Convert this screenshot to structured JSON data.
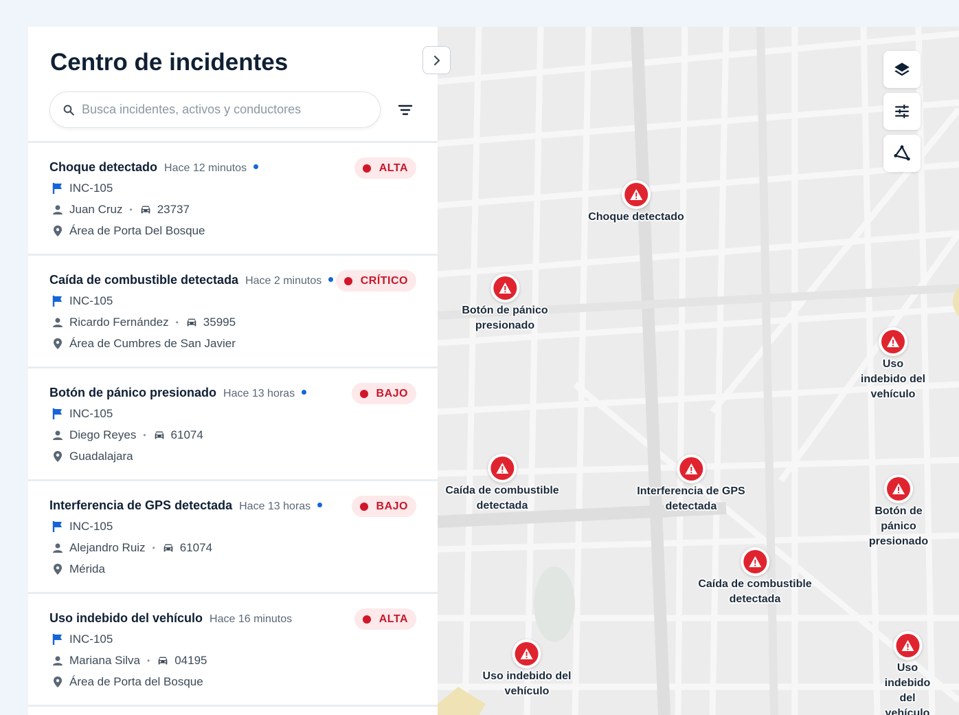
{
  "panel": {
    "title": "Centro de incidentes",
    "search_placeholder": "Busca incidentes, activos y conductores"
  },
  "colors": {
    "accent_red": "#e0242f",
    "flag_blue": "#1565d8",
    "badge_bg": "#fde8ea"
  },
  "icons": {
    "search": "search-icon",
    "filter": "filter-icon",
    "collapse": "chevron-right-icon",
    "flag": "flag-icon",
    "driver": "person-icon",
    "vehicle": "car-icon",
    "location": "location-pin-icon",
    "layers": "layers-icon",
    "settings": "sliders-icon",
    "draw": "polygon-icon",
    "alert": "warning-triangle-icon"
  },
  "incidents": [
    {
      "title": "Choque detectado",
      "time": "Hace 12 minutos",
      "unread": true,
      "severity": "ALTA",
      "id": "INC-105",
      "driver": "Juan Cruz",
      "vehicle": "23737",
      "location": "Área de Porta Del Bosque"
    },
    {
      "title": "Caída de combustible detectada",
      "time": "Hace 2 minutos",
      "unread": true,
      "severity": "CRÍTICO",
      "id": "INC-105",
      "driver": "Ricardo Fernández",
      "vehicle": "35995",
      "location": "Área de Cumbres de San Javier"
    },
    {
      "title": "Botón de pánico presionado",
      "time": "Hace 13 horas",
      "unread": true,
      "severity": "BAJO",
      "id": "INC-105",
      "driver": "Diego Reyes",
      "vehicle": "61074",
      "location": "Guadalajara"
    },
    {
      "title": "Interferencia de GPS detectada",
      "time": "Hace 13 horas",
      "unread": true,
      "severity": "BAJO",
      "id": "INC-105",
      "driver": "Alejandro Ruiz",
      "vehicle": "61074",
      "location": "Mérida"
    },
    {
      "title": "Uso indebido del vehículo",
      "time": "Hace 16 minutos",
      "unread": false,
      "severity": "ALTA",
      "id": "INC-105",
      "driver": "Mariana Silva",
      "vehicle": "04195",
      "location": "Área de Porta del Bosque"
    }
  ],
  "map_markers": [
    {
      "label": "Choque detectado"
    },
    {
      "label": "Botón de pánico\npresionado"
    },
    {
      "label": "Uso indebido del\nvehículo"
    },
    {
      "label": "Caída de combustible\ndetectada"
    },
    {
      "label": "Interferencia de GPS\ndetectada"
    },
    {
      "label": "Botón de pánico\npresionado"
    },
    {
      "label": "Caída de combustible\ndetectada"
    },
    {
      "label": "Uso indebido del\nvehículo"
    },
    {
      "label": "Uso indebido del\nvehículo"
    }
  ]
}
